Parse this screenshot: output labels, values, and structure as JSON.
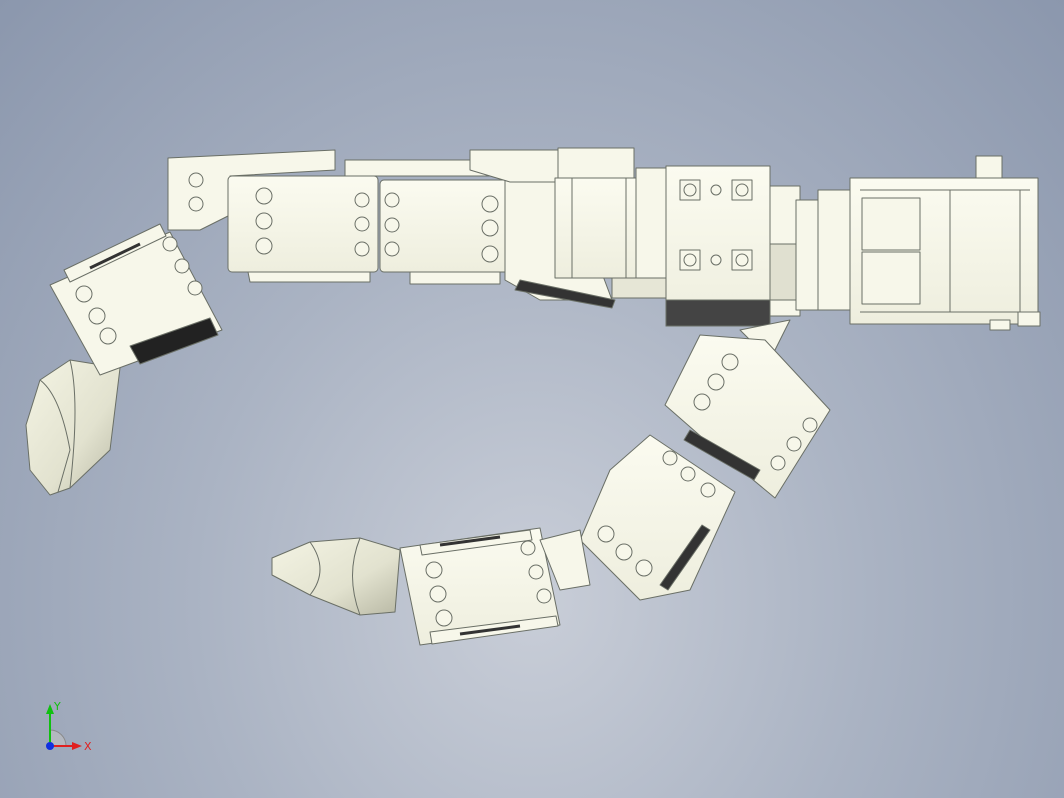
{
  "viewport": {
    "background_top": "#8b97ad",
    "background_bottom": "#c9ced8",
    "part_color": "#f7f7ea",
    "edge_color": "#6a6f66"
  },
  "triad": {
    "x_label": "X",
    "y_label": "Y",
    "x_color": "#e02020",
    "y_color": "#10c010",
    "z_color": "#1030e0"
  }
}
